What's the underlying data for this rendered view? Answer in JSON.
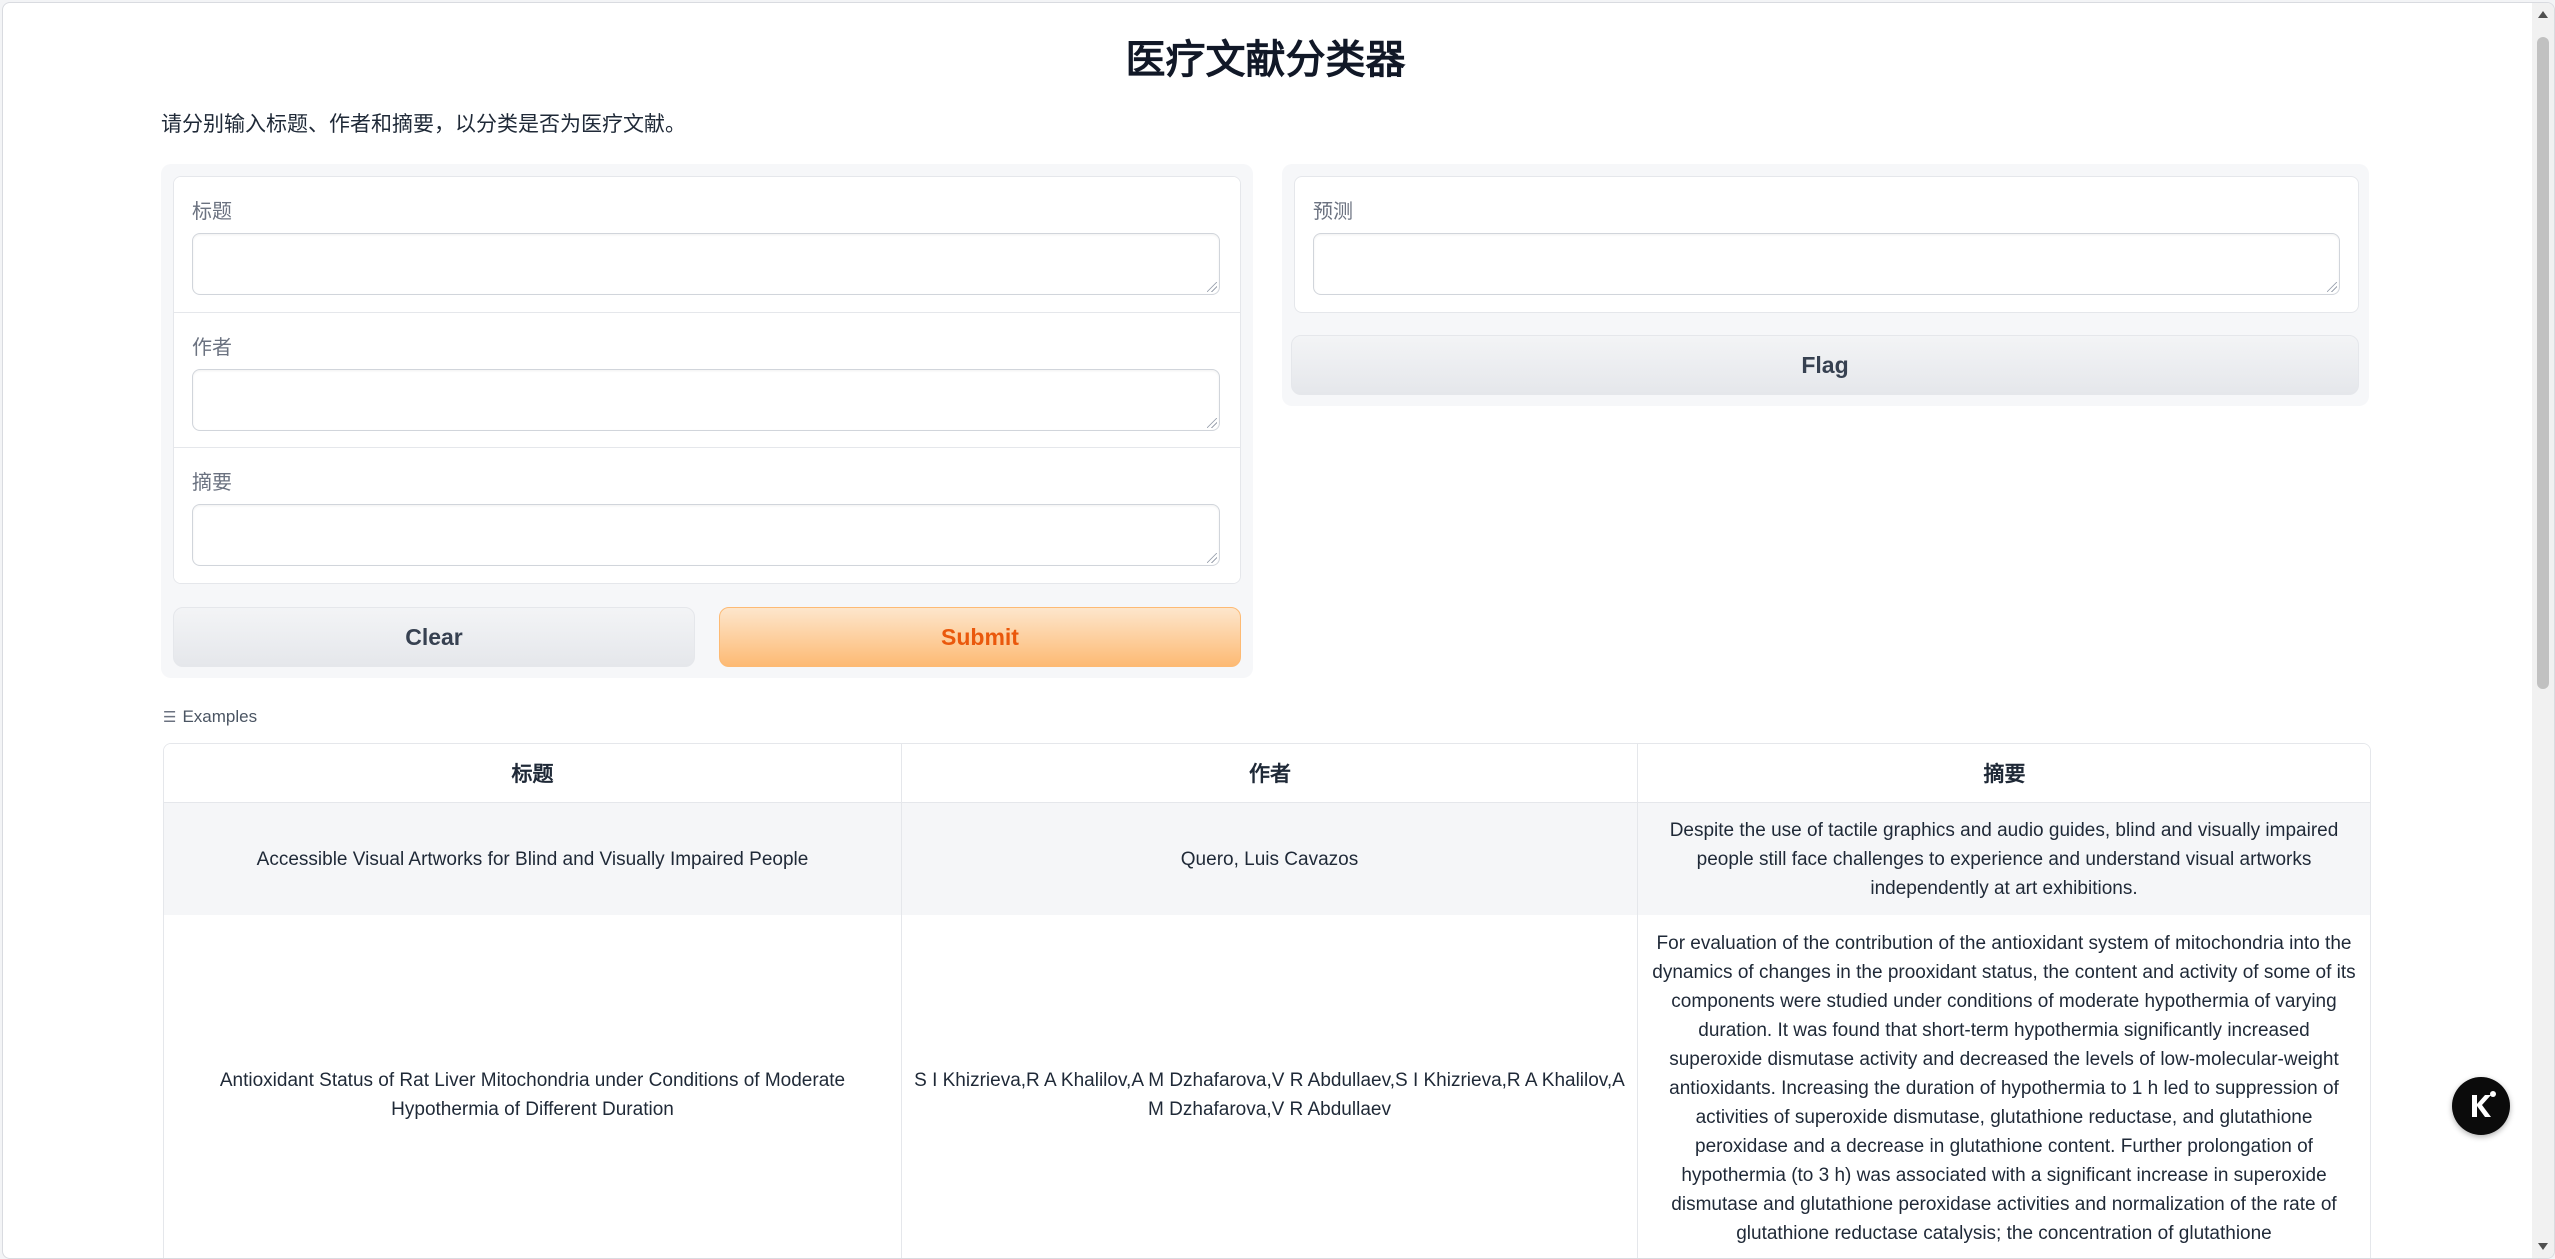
{
  "page": {
    "title": "医疗文献分类器",
    "description": "请分别输入标题、作者和摘要，以分类是否为医疗文献。"
  },
  "inputs": {
    "title_label": "标题",
    "author_label": "作者",
    "abstract_label": "摘要",
    "title_value": "",
    "author_value": "",
    "abstract_value": ""
  },
  "buttons": {
    "clear": "Clear",
    "submit": "Submit",
    "flag": "Flag"
  },
  "output": {
    "label": "预测",
    "value": ""
  },
  "examples": {
    "label": "Examples",
    "headers": [
      "标题",
      "作者",
      "摘要"
    ],
    "rows": [
      {
        "title": "Accessible Visual Artworks for Blind and Visually Impaired People",
        "author": "Quero, Luis Cavazos",
        "abstract": "Despite the use of tactile graphics and audio guides, blind and visually impaired people still face challenges to experience and understand visual artworks independently at art exhibitions."
      },
      {
        "title": "Antioxidant Status of Rat Liver Mitochondria under Conditions of Moderate Hypothermia of Different Duration",
        "author": "S I Khizrieva,R A Khalilov,A M Dzhafarova,V R Abdullaev,S I Khizrieva,R A Khalilov,A M Dzhafarova,V R Abdullaev",
        "abstract": "For evaluation of the contribution of the antioxidant system of mitochondria into the dynamics of changes in the prooxidant status, the content and activity of some of its components were studied under conditions of moderate hypothermia of varying duration. It was found that short-term hypothermia significantly increased superoxide dismutase activity and decreased the levels of low-molecular-weight antioxidants. Increasing the duration of hypothermia to 1 h led to suppression of activities of superoxide dismutase, glutathione reductase, and glutathione peroxidase and a decrease in glutathione content. Further prolongation of hypothermia (to 3 h) was associated with a significant increase in superoxide dismutase and glutathione peroxidase activities and normalization of the rate of glutathione reductase catalysis; the concentration of glutathione"
      }
    ]
  },
  "icons": {
    "examples": "list-icon",
    "floating": "brand-logo-icon"
  },
  "colors": {
    "primary_text": "#ea580c",
    "primary_bg": "#fdba74"
  }
}
